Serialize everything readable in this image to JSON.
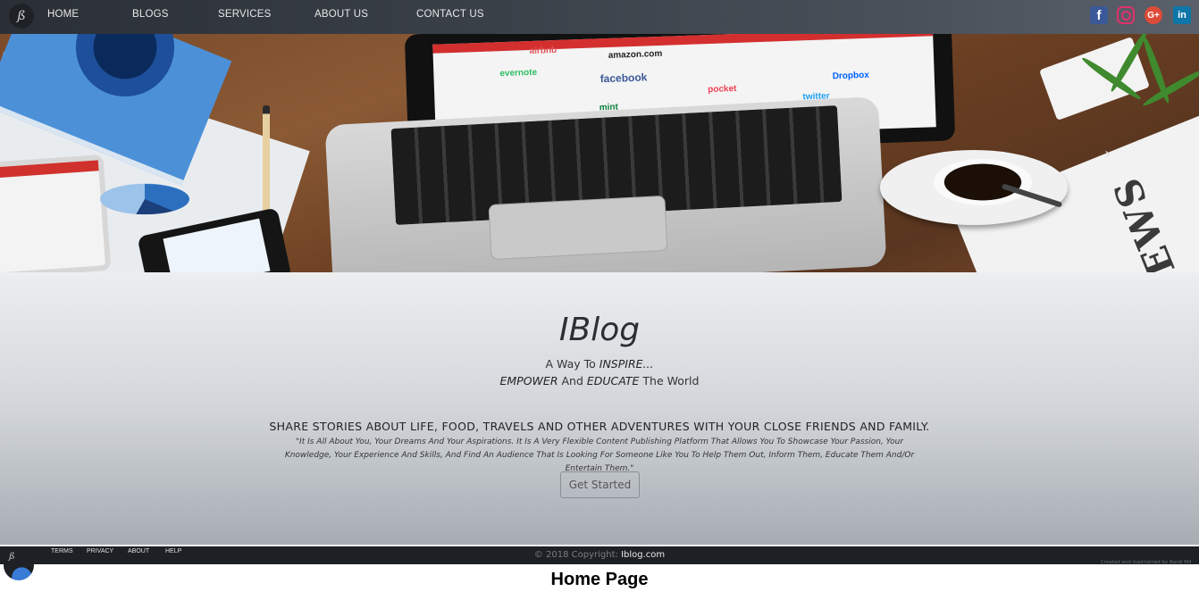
{
  "nav": {
    "logo_glyph": "ß",
    "items": [
      {
        "label": "HOME"
      },
      {
        "label": "BLOGS"
      },
      {
        "label": "SERVICES"
      },
      {
        "label": "ABOUT US"
      },
      {
        "label": "CONTACT US"
      }
    ],
    "social": [
      {
        "name": "facebook-icon",
        "glyph": "f",
        "color": "#3b5998"
      },
      {
        "name": "instagram-icon",
        "glyph": "",
        "color": "#e1306c"
      },
      {
        "name": "google-plus-icon",
        "glyph": "G+",
        "color": "#dd4b39"
      },
      {
        "name": "linkedin-icon",
        "glyph": "in",
        "color": "#0e76a8"
      }
    ]
  },
  "hero": {
    "screen_brands": [
      "airbnb",
      "amazon.com",
      "evernote",
      "facebook",
      "Dropbox",
      "pocket",
      "mint",
      "twitter"
    ],
    "newspaper_text": "NEWS",
    "next_glyph": "›"
  },
  "content": {
    "title": "IBlog",
    "tagline_line1_prefix": "A Way To ",
    "tagline_line1_em": "INSPIRE...",
    "tagline_line2_em1": "EMPOWER",
    "tagline_line2_mid": " And ",
    "tagline_line2_em2": "EDUCATE",
    "tagline_line2_suffix": " The World",
    "share_heading": "SHARE STORIES ABOUT LIFE, FOOD, TRAVELS AND OTHER ADVENTURES WITH YOUR CLOSE FRIENDS AND FAMILY.",
    "quote": "\"It Is All About You, Your Dreams And Your Aspirations. It Is A Very Flexible Content Publishing Platform That Allows You To Showcase Your Passion, Your Knowledge, Your Experience And Skills, And Find An Audience That Is Looking For Someone Like You To Help Them Out, Inform Them, Educate Them And/Or Entertain Them.\"",
    "cta_label": "Get Started"
  },
  "footer": {
    "logo_glyph": "ß",
    "links": [
      {
        "label": "TERMS"
      },
      {
        "label": "PRIVACY"
      },
      {
        "label": "ABOUT"
      },
      {
        "label": "HELP"
      }
    ],
    "copyright_prefix": "© 2018 Copyright: ",
    "copyright_link": "Iblog.com",
    "credit": "Created and maintained by Bardi Md"
  },
  "caption": "Home Page",
  "colors": {
    "accent": "#d32f2f"
  }
}
